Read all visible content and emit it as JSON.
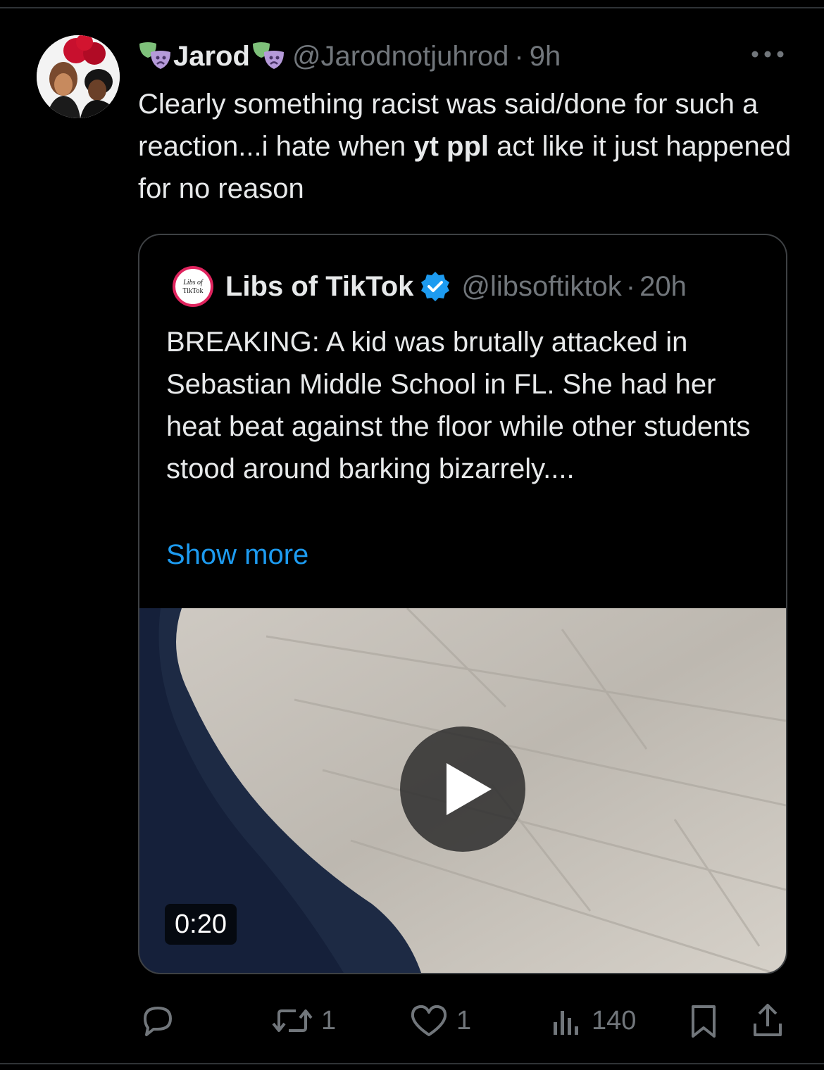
{
  "tweet": {
    "display_name": "Jarod",
    "handle": "@Jarodnotjuhrod",
    "separator": "·",
    "time": "9h",
    "text_part1": "Clearly something racist was said/done for such a reaction...i hate when ",
    "text_bold": "yt ppl",
    "text_part2": " act like it just happened for no reason"
  },
  "quote": {
    "display_name": "Libs of TikTok",
    "handle": "@libsoftiktok",
    "separator": "·",
    "time": "20h",
    "avatar_text_line1": "Libs of",
    "avatar_text_line2": "TikTok",
    "text": "BREAKING: A kid was brutally attacked in Sebastian Middle School in FL.  She had her heat beat against the floor while other students stood around barking bizarrely....",
    "show_more": "Show more",
    "video_duration": "0:20"
  },
  "actions": {
    "replies": "",
    "reposts": "1",
    "likes": "1",
    "views": "140"
  },
  "icons": [
    "mask-icon",
    "more-icon",
    "verified-icon",
    "play-icon",
    "reply-icon",
    "repost-icon",
    "like-icon",
    "views-icon",
    "bookmark-icon",
    "share-icon"
  ],
  "colors": {
    "background": "#000000",
    "text": "#e7e9ea",
    "secondary": "#71767b",
    "accent": "#1d9bf0",
    "border": "#3e4144"
  }
}
